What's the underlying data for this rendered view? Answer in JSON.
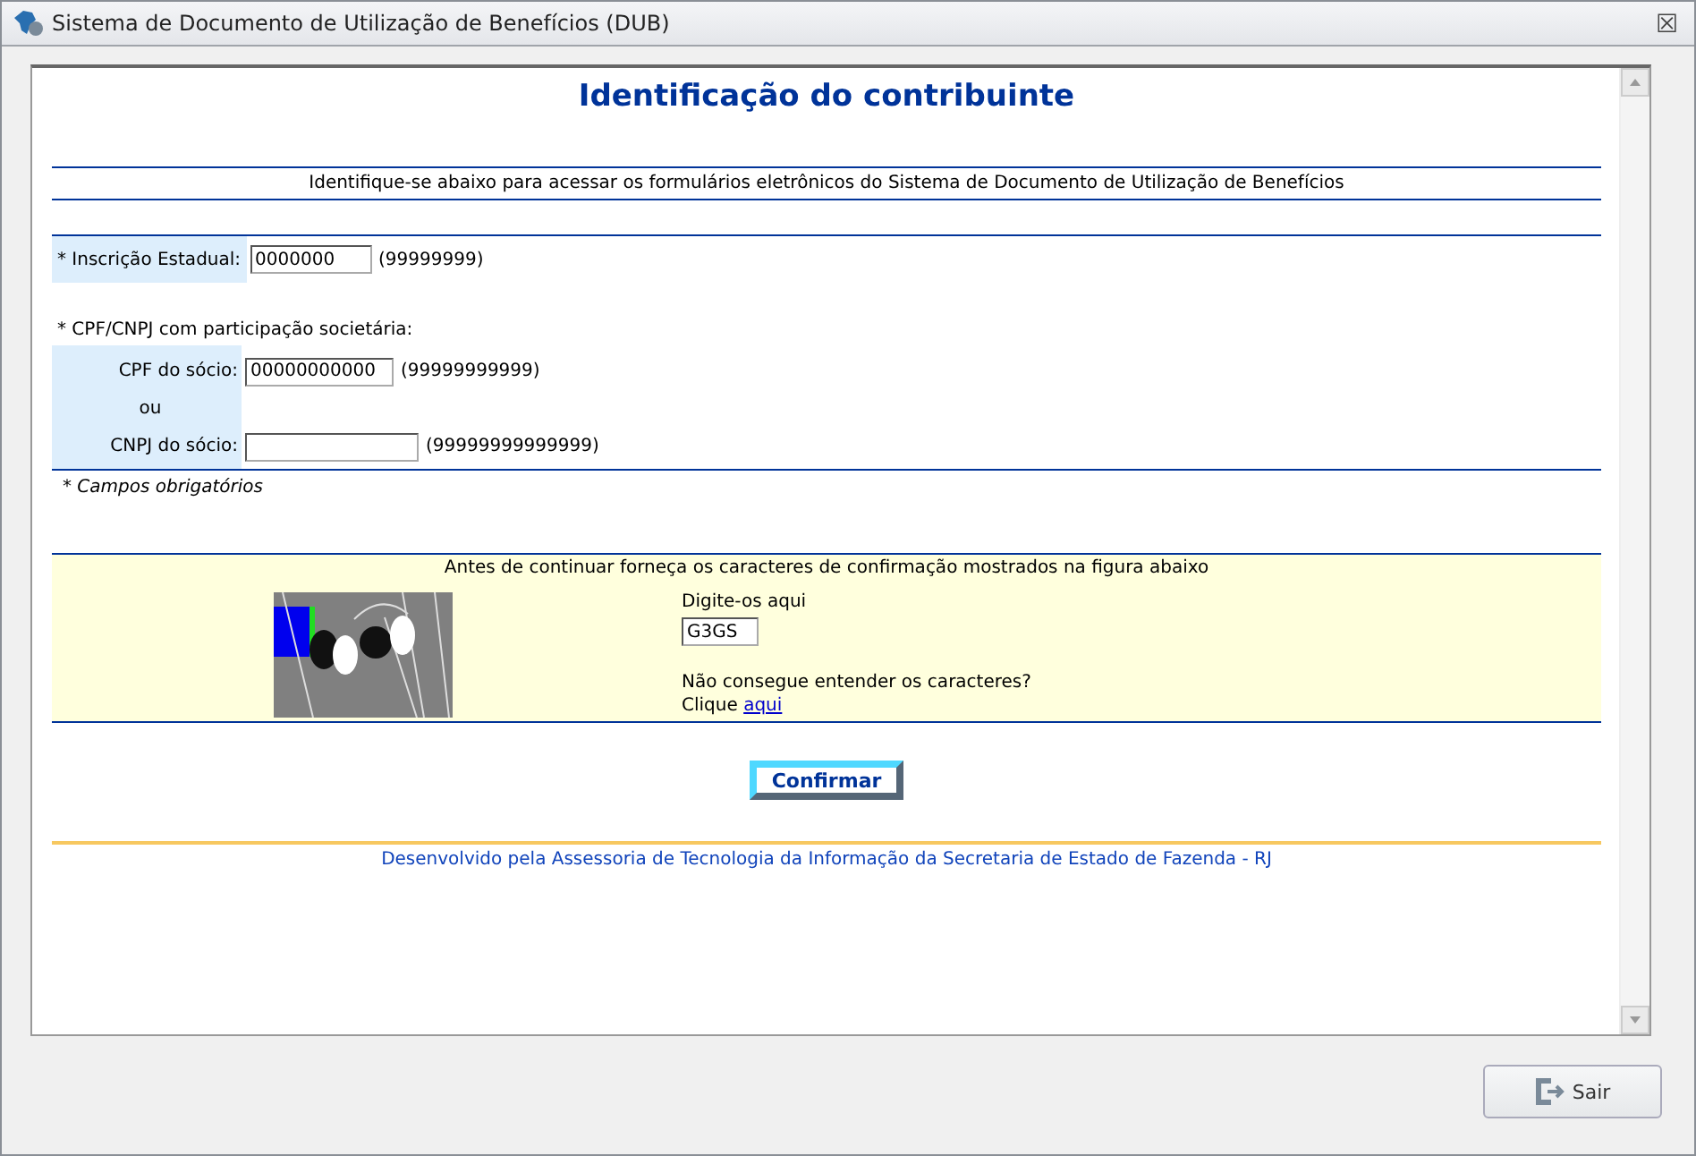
{
  "window": {
    "title": "Sistema de Documento de Utilização de Benefícios (DUB)",
    "close": "☒"
  },
  "page": {
    "heading": "Identificação do contribuinte",
    "intro": "Identifique-se abaixo para acessar os formulários eletrônicos do Sistema de Documento de Utilização de Benefícios"
  },
  "form": {
    "ie": {
      "label": "* Inscrição Estadual:",
      "value": "0000000",
      "hint": "(99999999)"
    },
    "group_label": "* CPF/CNPJ com participação societária:",
    "cpf": {
      "label": "CPF do sócio:",
      "value": "00000000000",
      "hint": "(99999999999)"
    },
    "or": "ou",
    "cnpj": {
      "label": "CNPJ do sócio:",
      "hint": "(99999999999999)"
    },
    "required_note": "* Campos obrigatórios"
  },
  "captcha": {
    "instruction": "Antes de continuar forneça os caracteres de confirmação mostrados na figura abaixo",
    "field_label": "Digite-os aqui",
    "value": "G3GS",
    "help": "Não consegue entender os caracteres?",
    "click": "Clique",
    "link": "aqui"
  },
  "confirm_button": "Confirmar",
  "footer": "Desenvolvido pela Assessoria de Tecnologia da Informação da Secretaria de Estado de Fazenda - RJ",
  "exit_button": "Sair"
}
